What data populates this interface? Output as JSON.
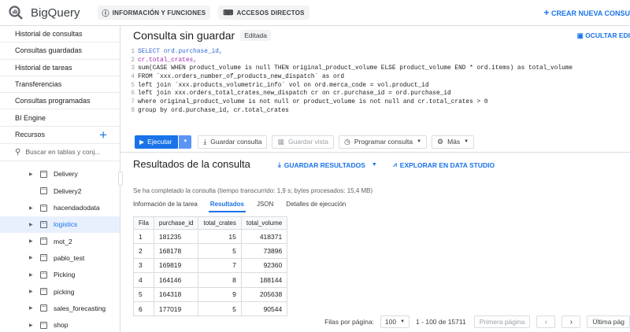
{
  "header": {
    "app_name": "BigQuery",
    "chip_info": "INFORMACIÓN Y FUNCIONES",
    "chip_shortcuts": "ACCESOS DIRECTOS",
    "create_query": "CREAR NUEVA CONSU"
  },
  "sidebar": {
    "items": [
      "Historial de consultas",
      "Consultas guardadas",
      "Historial de tareas",
      "Transferencias",
      "Consultas programadas",
      "BI Engine"
    ],
    "resources_label": "Recursos",
    "search_placeholder": "Buscar en tablas y conj...",
    "datasets": [
      "Delivery",
      "Delivery2",
      "hacendadodata",
      "logistics",
      "mot_2",
      "pablo_test",
      "Picking",
      "picking",
      "sales_forecasting",
      "shop"
    ]
  },
  "editor": {
    "title": "Consulta sin guardar",
    "badge": "Editada",
    "hide_label": "OCULTAR EDI",
    "lines": [
      [
        "1",
        "SELECT ord.purchase_id,"
      ],
      [
        "2",
        "cr.total_crates,"
      ],
      [
        "3",
        "sum(CASE WHEN product_volume is null THEN original_product_volume ELSE product_volume END * ord.items) as total_volume"
      ],
      [
        "4",
        "FROM `xxx.orders_number_of_products_new_dispatch` as ord"
      ],
      [
        "5",
        "left join `xxx.products_volumetric_info` vol on ord.merca_code = vol.product_id"
      ],
      [
        "6",
        "left join xxx.orders_total_crates_new_dispatch cr on cr.purchase_id = ord.purchase_id"
      ],
      [
        "7",
        "where original_product_volume is not null or product_volume is not null and cr.total_crates > 0"
      ],
      [
        "8",
        "group by ord.purchase_id, cr.total_crates"
      ]
    ]
  },
  "toolbar": {
    "run": "Ejecutar",
    "save": "Guardar consulta",
    "save_view": "Guardar vista",
    "schedule": "Programar consulta",
    "more": "Más"
  },
  "results": {
    "title": "Resultados de la consulta",
    "save_results": "GUARDAR RESULTADOS",
    "explore": "EXPLORAR EN DATA STUDIO",
    "status": "Se ha completado la consulta (tiempo transcurrido: 1,9 s; bytes procesados: 15,4 MB)",
    "tabs": [
      "Información de la tarea",
      "Resultados",
      "JSON",
      "Detalles de ejecución"
    ],
    "columns": [
      "Fila",
      "purchase_id",
      "total_crates",
      "total_volume"
    ],
    "rows": [
      [
        "1",
        "181235",
        "15",
        "418371"
      ],
      [
        "2",
        "168178",
        "5",
        "73896"
      ],
      [
        "3",
        "169819",
        "7",
        "92360"
      ],
      [
        "4",
        "164146",
        "8",
        "188144"
      ],
      [
        "5",
        "164318",
        "9",
        "205638"
      ],
      [
        "6",
        "177019",
        "5",
        "90544"
      ]
    ]
  },
  "pager": {
    "rows_label": "Filas por página:",
    "page_size": "100",
    "range": "1 - 100 de 15711",
    "first": "Primera página",
    "last": "Última pág"
  }
}
